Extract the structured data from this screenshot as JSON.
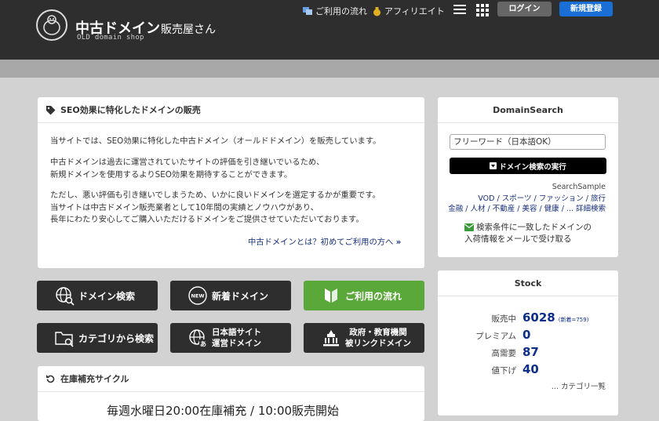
{
  "header": {
    "logo_title": "中古ドメイン",
    "logo_title_suffix": "販売屋さん",
    "logo_subtitle": "OLD domain shop",
    "links": [
      {
        "label": "ご利用の流れ",
        "icon": "flow-icon"
      },
      {
        "label": "アフィリエイト",
        "icon": "moneybag-icon"
      }
    ],
    "login_label": "ログイン",
    "register_label": "新規登録"
  },
  "seo_panel": {
    "title": "SEO効果に特化したドメインの販売",
    "paragraphs": [
      [
        "当サイトでは、SEO効果に特化した中古ドメイン（オールドドメイン）を販売しています。"
      ],
      [
        "中古ドメインは過去に運営されていたサイトの評価を引き継いでいるため、",
        "新規ドメインを使用するよりSEO効果を期待することができます。"
      ],
      [
        "ただし、悪い評価も引き継いでしまうため、いかに良いドメインを選定するかが重要です。",
        "当サイトは中古ドメイン販売業者として10年間の実績とノウハウがあり、",
        "長年にわたり安心してご購入いただけるドメインをご提供させていただいております。"
      ]
    ],
    "link_label": "中古ドメインとは？初めてご利用の方へ",
    "link_arrow": "»"
  },
  "tiles": {
    "domain_search": "ドメイン検索",
    "new_domain": "新着ドメイン",
    "usage_flow": "ご利用の流れ",
    "category_search": "カテゴリから検索",
    "jp_site_line1": "日本語サイト",
    "jp_site_line2": "運営ドメイン",
    "gov_line1": "政府・教育機関",
    "gov_line2": "被リンクドメイン",
    "new_badge": "NEW"
  },
  "stock_cycle": {
    "title": "在庫補充サイクル",
    "text": "毎週水曜日20:00在庫補充 / 10:00販売開始"
  },
  "domain_search": {
    "title": "DomainSearch",
    "placeholder": "フリーワード（日本語OK）",
    "button_label": "ドメイン検索の実行",
    "sample_label": "SearchSample",
    "sample_line1": "VOD / スポーツ / ファッション / 旅行",
    "sample_line2": "金融 / 人材 / 不動産 / 美容 / 健康 / ... 詳細検索",
    "mail_line1": "検索条件に一致したドメインの",
    "mail_line2": "入荷情報をメールで受け取る"
  },
  "stock": {
    "title": "Stock",
    "rows": [
      {
        "label": "販売中",
        "value": "6028",
        "note": "(新着=759)"
      },
      {
        "label": "プレミアム",
        "value": "0",
        "note": ""
      },
      {
        "label": "高需要",
        "value": "87",
        "note": ""
      },
      {
        "label": "値下げ",
        "value": "40",
        "note": ""
      }
    ],
    "category_link": "... カテゴリ一覧"
  },
  "colors": {
    "header_bg": "#2e2e2e",
    "accent_blue": "#1a6fd6",
    "green_tile": "#5ba83a",
    "link_blue": "#17307a"
  }
}
